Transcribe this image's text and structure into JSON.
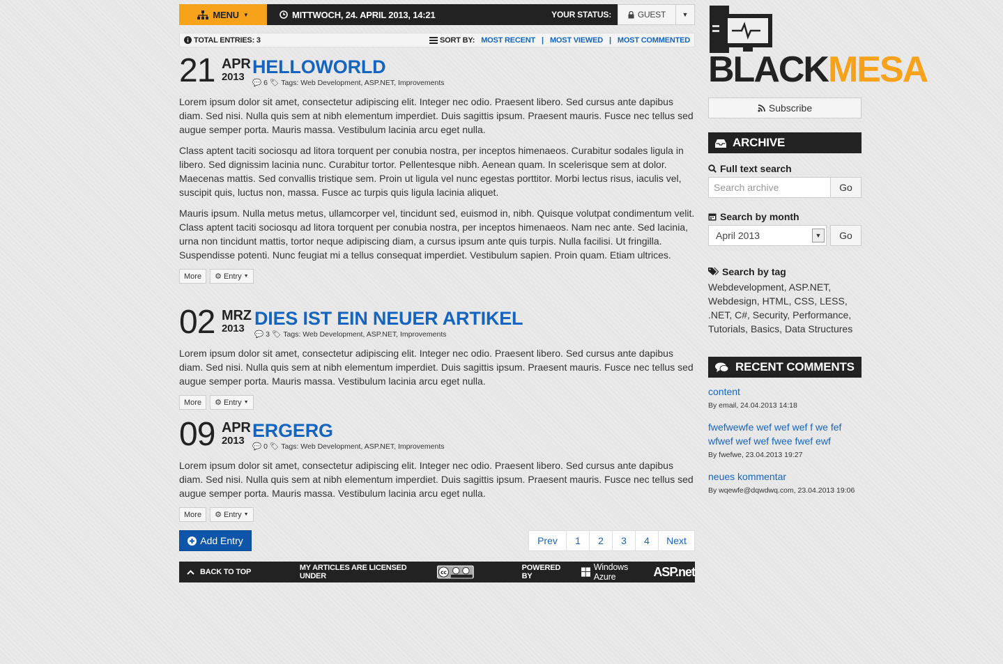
{
  "topbar": {
    "menu_label": "MENU",
    "datetime": "MITTWOCH, 24. APRIL 2013, 14:21",
    "status_label": "YOUR STATUS:",
    "guest_label": "GUEST"
  },
  "entriesbar": {
    "total": "TOTAL ENTRIES: 3",
    "sort_label": "SORT BY:",
    "sort_options": [
      "MOST RECENT",
      "MOST VIEWED",
      "MOST COMMENTED"
    ],
    "separator": "|"
  },
  "posts": [
    {
      "day": "21",
      "month": "APR",
      "year": "2013",
      "title": "HELLOWORLD",
      "comments": "6",
      "tags": "Tags: Web Development, ASP.NET, Improvements",
      "paragraphs": [
        "Lorem ipsum dolor sit amet, consectetur adipiscing elit. Integer nec odio. Praesent libero. Sed cursus ante dapibus diam. Sed nisi. Nulla quis sem at nibh elementum imperdiet. Duis sagittis ipsum. Praesent mauris. Fusce nec tellus sed augue semper porta. Mauris massa. Vestibulum lacinia arcu eget nulla.",
        "Class aptent taciti sociosqu ad litora torquent per conubia nostra, per inceptos himenaeos. Curabitur sodales ligula in libero. Sed dignissim lacinia nunc. Curabitur tortor. Pellentesque nibh. Aenean quam. In scelerisque sem at dolor. Maecenas mattis. Sed convallis tristique sem. Proin ut ligula vel nunc egestas porttitor. Morbi lectus risus, iaculis vel, suscipit quis, luctus non, massa. Fusce ac turpis quis ligula lacinia aliquet.",
        "Mauris ipsum. Nulla metus metus, ullamcorper vel, tincidunt sed, euismod in, nibh. Quisque volutpat condimentum velit. Class aptent taciti sociosqu ad litora torquent per conubia nostra, per inceptos himenaeos. Nam nec ante. Sed lacinia, urna non tincidunt mattis, tortor neque adipiscing diam, a cursus ipsum ante quis turpis. Nulla facilisi. Ut fringilla. Suspendisse potenti. Nunc feugiat mi a tellus consequat imperdiet. Vestibulum sapien. Proin quam. Etiam ultrices."
      ],
      "more_label": "More",
      "entry_label": "Entry"
    },
    {
      "day": "02",
      "month": "MRZ",
      "year": "2013",
      "title": "DIES IST EIN NEUER ARTIKEL",
      "comments": "3",
      "tags": "Tags: Web Development, ASP.NET, Improvements",
      "paragraphs": [
        "Lorem ipsum dolor sit amet, consectetur adipiscing elit. Integer nec odio. Praesent libero. Sed cursus ante dapibus diam. Sed nisi. Nulla quis sem at nibh elementum imperdiet. Duis sagittis ipsum. Praesent mauris. Fusce nec tellus sed augue semper porta. Mauris massa. Vestibulum lacinia arcu eget nulla."
      ],
      "more_label": "More",
      "entry_label": "Entry"
    },
    {
      "day": "09",
      "month": "APR",
      "year": "2013",
      "title": "ERGERG",
      "comments": "0",
      "tags": "Tags: Web Development, ASP.NET, Improvements",
      "paragraphs": [
        "Lorem ipsum dolor sit amet, consectetur adipiscing elit. Integer nec odio. Praesent libero. Sed cursus ante dapibus diam. Sed nisi. Nulla quis sem at nibh elementum imperdiet. Duis sagittis ipsum. Praesent mauris. Fusce nec tellus sed augue semper porta. Mauris massa. Vestibulum lacinia arcu eget nulla."
      ],
      "more_label": "More",
      "entry_label": "Entry"
    }
  ],
  "add_entry_label": "Add Entry",
  "pager": [
    "Prev",
    "1",
    "2",
    "3",
    "4",
    "Next"
  ],
  "footer": {
    "back_to_top": "BACK TO TOP",
    "license": "MY ARTICLES ARE LICENSED UNDER",
    "powered_by": "POWERED BY",
    "azure": "Windows Azure",
    "aspnet": "ASP.net"
  },
  "sidebar": {
    "logo_black": "BLACK",
    "logo_mesa": "MESA",
    "subscribe_label": "Subscribe",
    "archive_title": "ARCHIVE",
    "fulltext_label": "Full text search",
    "search_placeholder": "Search archive",
    "go_label": "Go",
    "month_label": "Search by month",
    "month_value": "April 2013",
    "tag_label": "Search by tag",
    "tags": "Webdevelopment, ASP.NET, Webdesign, HTML, CSS, LESS, .NET, C#, Security, Performance, Tutorials, Basics, Data Structures",
    "recent_title": "RECENT COMMENTS",
    "comments": [
      {
        "text": "content",
        "meta": "By email, 24.04.2013 14:18"
      },
      {
        "text": "fwefwewfe wef wef wef f we fef wfwef wef wef fwee fwef ewf",
        "meta": "By fwefwe, 23.04.2013 19:27"
      },
      {
        "text": "neues kommentar",
        "meta": "By wqewfe@dqwdwq.com, 23.04.2013 19:06"
      }
    ]
  },
  "colors": {
    "accent": "#f7a21b",
    "link": "#1565c0",
    "dark": "#222222",
    "primary_button": "#0d55a8"
  }
}
